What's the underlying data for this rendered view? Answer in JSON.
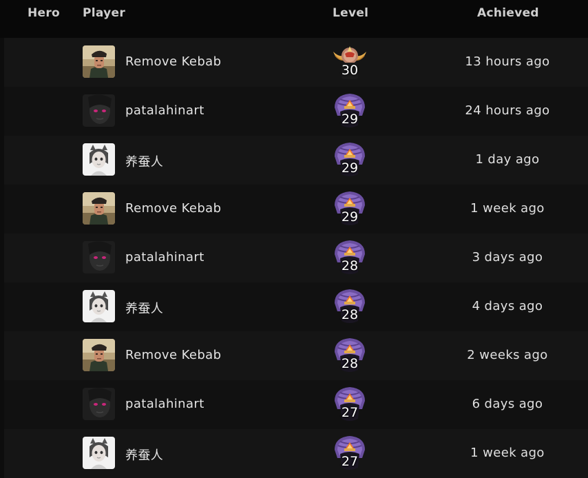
{
  "header": {
    "hero": "Hero",
    "player": "Player",
    "level": "Level",
    "achieved": "Achieved"
  },
  "colors": {
    "badge_purple": "#6a4fa0",
    "badge_gold": "#e0a84a",
    "badge_ember": "#f07a2a"
  },
  "rows": [
    {
      "player": "Remove Kebab",
      "avatar": "soldier",
      "level": "30",
      "badge": "gold-winged",
      "achieved": "13 hours ago"
    },
    {
      "player": "patalahinart",
      "avatar": "dark-face",
      "level": "29",
      "badge": "purple-crest",
      "achieved": "24 hours ago"
    },
    {
      "player": "养蚕人",
      "avatar": "white-cat-girl",
      "level": "29",
      "badge": "purple-crest",
      "achieved": "1 day ago"
    },
    {
      "player": "Remove Kebab",
      "avatar": "soldier",
      "level": "29",
      "badge": "purple-crest",
      "achieved": "1 week ago"
    },
    {
      "player": "patalahinart",
      "avatar": "dark-face",
      "level": "28",
      "badge": "purple-crest",
      "achieved": "3 days ago"
    },
    {
      "player": "养蚕人",
      "avatar": "white-cat-girl",
      "level": "28",
      "badge": "purple-crest",
      "achieved": "4 days ago"
    },
    {
      "player": "Remove Kebab",
      "avatar": "soldier",
      "level": "28",
      "badge": "purple-crest",
      "achieved": "2 weeks ago"
    },
    {
      "player": "patalahinart",
      "avatar": "dark-face",
      "level": "27",
      "badge": "purple-crest",
      "achieved": "6 days ago"
    },
    {
      "player": "养蚕人",
      "avatar": "white-cat-girl",
      "level": "27",
      "badge": "purple-crest",
      "achieved": "1 week ago"
    }
  ]
}
